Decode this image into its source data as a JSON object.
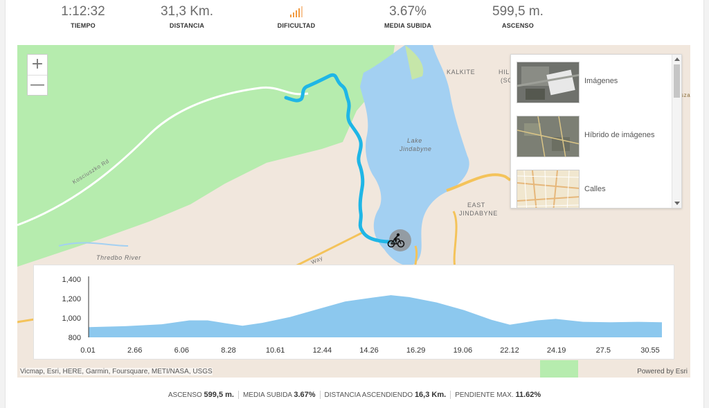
{
  "stats": [
    {
      "value": "1:12:32",
      "label": "TIEMPO"
    },
    {
      "value": "31,3 Km.",
      "label": "DISTANCIA"
    },
    {
      "value": "",
      "label": "DIFICULTAD",
      "icon": "difficulty-bars-icon",
      "color": "#f29a3f"
    },
    {
      "value": "3.67%",
      "label": "MEDIA SUBIDA"
    },
    {
      "value": "599,5 m.",
      "label": "ASCENSO"
    }
  ],
  "map": {
    "zoom_in": "+",
    "zoom_out": "—",
    "labels": {
      "kalkite": "KALKITE",
      "hill_a": "HIL",
      "hill_b": "(SC",
      "lake_1": "Lake",
      "lake_2": "Jindabyne",
      "east_1": "EAST",
      "east_2": "JINDABYNE",
      "road": "Kosciuszko Rd",
      "river": "Thredbo River",
      "way": "Way",
      "edge": "sza"
    },
    "route_color": "#1fb6e6",
    "lake_color": "#a3d0f2",
    "park_color": "#b6ecae",
    "attribution": "Vicmap, Esri, HERE, Garmin, Foursquare, METI/NASA, USGS",
    "powered_by": "Powered by Esri",
    "rider_icon": "cyclist-icon"
  },
  "gallery": {
    "items": [
      {
        "label": "Imágenes",
        "icon": "imagery-thumb"
      },
      {
        "label": "Híbrido de imágenes",
        "icon": "hybrid-thumb"
      },
      {
        "label": "Calles",
        "icon": "streets-thumb"
      }
    ]
  },
  "chart_data": {
    "type": "area",
    "x_ticks": [
      "0.01",
      "2.66",
      "6.06",
      "8.28",
      "10.61",
      "12.44",
      "14.26",
      "16.29",
      "19.06",
      "22.12",
      "24.19",
      "27.5",
      "30.55"
    ],
    "y_ticks": [
      "800",
      "1,000",
      "1,200",
      "1,400"
    ],
    "ylim": [
      800,
      1400
    ],
    "xlim": [
      0,
      31.3
    ],
    "color": "#8cc8ee",
    "series": [
      {
        "x": [
          0,
          2,
          4,
          5.5,
          6.5,
          7.5,
          8.4,
          9.5,
          11,
          12.5,
          14,
          15.5,
          16.5,
          17.5,
          19,
          20.5,
          22,
          23,
          24.5,
          25.5,
          27,
          28.5,
          30,
          31.3
        ],
        "y": [
          905,
          915,
          935,
          975,
          975,
          945,
          920,
          950,
          1010,
          1090,
          1170,
          1210,
          1235,
          1215,
          1160,
          1080,
          980,
          930,
          975,
          990,
          960,
          955,
          960,
          955
        ]
      }
    ]
  },
  "footer": {
    "ascent_label": "ASCENSO",
    "ascent_value": "599,5 m.",
    "avg_label": "MEDIA SUBIDA",
    "avg_value": "3.67%",
    "climb_label": "DISTANCIA ASCENDIENDO",
    "climb_value": "16,3 Km.",
    "max_label": "PENDIENTE MAX.",
    "max_value": "11.62%"
  }
}
